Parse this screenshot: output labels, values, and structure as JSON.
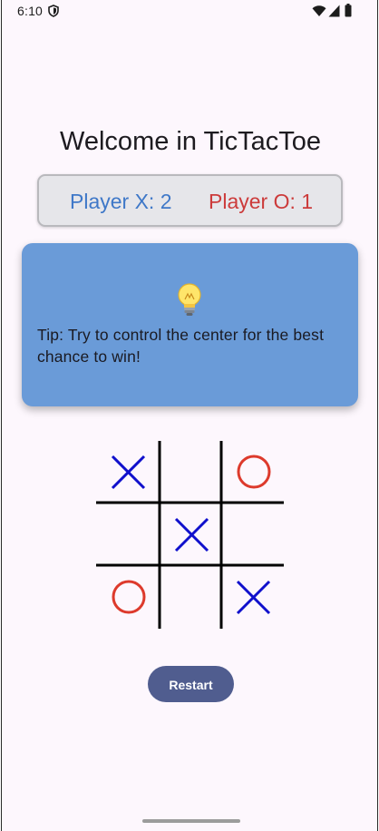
{
  "status_bar": {
    "time": "6:10",
    "icons": [
      "shield-icon",
      "wifi-icon",
      "signal-icon",
      "battery-icon"
    ]
  },
  "title": "Welcome in TicTacToe",
  "score": {
    "player_x": "Player X: 2",
    "player_o": "Player O: 1",
    "x_color": "#3f78c8",
    "o_color": "#cc3b3b"
  },
  "tip": {
    "icon": "lightbulb-icon",
    "label": "Tip:",
    "text": " Try to control the center for the best chance to win!",
    "background": "#6a9bd8"
  },
  "board": {
    "cells": [
      "X",
      "",
      "O",
      "",
      "X",
      "",
      "O",
      "",
      "X"
    ],
    "x_color": "#1010cc",
    "o_color": "#dd3a2c"
  },
  "restart_label": "Restart",
  "colors": {
    "background": "#fdf7fd",
    "button": "#505d8f"
  }
}
